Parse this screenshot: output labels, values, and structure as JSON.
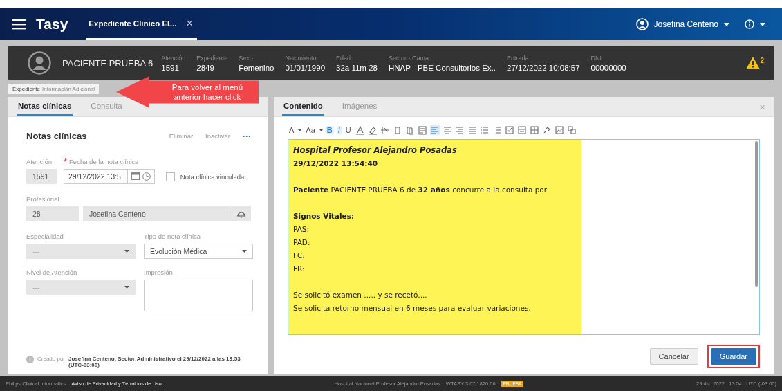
{
  "app": {
    "logo": "Tasy",
    "tabs": [
      {
        "label": "Expediente Clínico EL..",
        "selected": true,
        "close": "×"
      }
    ],
    "user": "Josefina Centeno"
  },
  "patient": {
    "name": "PACIENTE PRUEBA 6",
    "fields": [
      {
        "label": "Atención",
        "value": "1591"
      },
      {
        "label": "Expediente",
        "value": "2849"
      },
      {
        "label": "Sexo",
        "value": "Femenino"
      },
      {
        "label": "Nacimiento",
        "value": "01/01/1990"
      },
      {
        "label": "Edad",
        "value": "32a 11m 28"
      },
      {
        "label": "Sector - Cama",
        "value": "HNAP - PBE Consultorios Ex.."
      },
      {
        "label": "Entrada",
        "value": "27/12/2022 10:08:57"
      },
      {
        "label": "DNI",
        "value": "00000000"
      }
    ],
    "alert_count": "2"
  },
  "breadcrumb": {
    "current": "Expediente",
    "link": "Información Adicional"
  },
  "callout": "Para volver al menú anterior hacer click",
  "left_panel": {
    "tabs": [
      {
        "label": "Notas clínicas",
        "selected": true
      },
      {
        "label": "Consulta",
        "selected": false
      }
    ],
    "title": "Notas clínicas",
    "actions": [
      "Eliminar",
      "Inactivar"
    ],
    "more": "···",
    "atencion": {
      "label": "Atención",
      "value": "1591"
    },
    "fecha": {
      "label": "Fecha de la nota clínica",
      "required_mark": "*",
      "value": "29/12/2022 13:5:"
    },
    "vinculada": {
      "label": "Nota clínica vinculada",
      "checked": false
    },
    "profesional": {
      "label": "Profesional",
      "code": "28",
      "name": "Josefina Centeno"
    },
    "especialidad": {
      "label": "Especialidad",
      "value": "---",
      "disabled": true
    },
    "tipo": {
      "label": "Tipo de nota clínica",
      "value": "Evolución Médica",
      "disabled": false
    },
    "nivel": {
      "label": "Nivel de Atención",
      "value": "---",
      "disabled": true
    },
    "impresion": {
      "label": "Impresión"
    },
    "created_label": "Creado por",
    "created_text": "Josefina Centeno, Sector:Administrativo el 29/12/2022 a las 13:53 (UTC-03:00)"
  },
  "right_panel": {
    "tabs": [
      {
        "label": "Contenido",
        "selected": true
      },
      {
        "label": "Imágenes",
        "selected": false
      }
    ],
    "close": "×",
    "toolbar_text": [
      {
        "label": "A",
        "kind": "menu",
        "selected": false
      },
      {
        "label": "Aa",
        "kind": "menu",
        "selected": false
      },
      {
        "label": "B",
        "kind": "bold",
        "selected": true
      },
      {
        "label": "I",
        "kind": "italic",
        "selected": true
      },
      {
        "label": "U",
        "kind": "underline",
        "selected": false
      }
    ],
    "toolbar_icons": [
      {
        "kind": "font-color",
        "selected": false
      },
      {
        "kind": "highlight",
        "selected": false
      },
      {
        "kind": "strike",
        "selected": false
      },
      {
        "kind": "copy",
        "selected": false
      },
      {
        "kind": "paste",
        "selected": false
      },
      {
        "kind": "paste-text",
        "selected": false
      },
      {
        "kind": "align-left",
        "selected": true
      },
      {
        "kind": "align-center",
        "selected": false
      },
      {
        "kind": "align-right",
        "selected": false
      },
      {
        "kind": "justify",
        "selected": false
      },
      {
        "kind": "bullets",
        "selected": false
      },
      {
        "kind": "numbers",
        "selected": false
      },
      {
        "kind": "checkbox",
        "selected": false
      },
      {
        "kind": "field",
        "selected": false
      },
      {
        "kind": "table",
        "selected": false
      },
      {
        "kind": "link",
        "selected": false
      },
      {
        "kind": "image",
        "selected": false
      },
      {
        "kind": "template",
        "selected": false
      }
    ],
    "lines": [
      {
        "kind": "title",
        "text": "Hospital Profesor Alejandro Posadas"
      },
      {
        "kind": "bold",
        "text": "29/12/2022 13:54:40"
      },
      {
        "kind": "blank"
      },
      {
        "kind": "text",
        "text": "**Paciente** PACIENTE PRUEBA 6  de **32 años**  concurre a la consulta por"
      },
      {
        "kind": "blank"
      },
      {
        "kind": "bold",
        "text": "Signos Vitales:"
      },
      {
        "kind": "text",
        "text": "PAS:"
      },
      {
        "kind": "text",
        "text": "PAD:"
      },
      {
        "kind": "text",
        "text": "FC:"
      },
      {
        "kind": "text",
        "text": "FR:"
      },
      {
        "kind": "blank"
      },
      {
        "kind": "text",
        "text": "Se solicitó examen .....  y se recetó...."
      },
      {
        "kind": "text",
        "text": "Se solicita retorno mensual en 6 meses para evaluar variaciones."
      }
    ],
    "buttons": [
      {
        "label": "Cancelar",
        "kind": "secondary",
        "highlighted": false
      },
      {
        "label": "Guardar",
        "kind": "primary",
        "highlighted": true
      }
    ]
  },
  "footer": {
    "company": "Philips Clinical Informatics",
    "privacy": "Aviso de Privacidad y Términos de Uso",
    "hospital": "Hospital Nacional Profesor Alejandro Posadas",
    "version": "WTASY 3.07.1820.06",
    "env": "PRUEBA",
    "datetime": "29 dic. 2022   13:54   UTC (-03:00)"
  }
}
